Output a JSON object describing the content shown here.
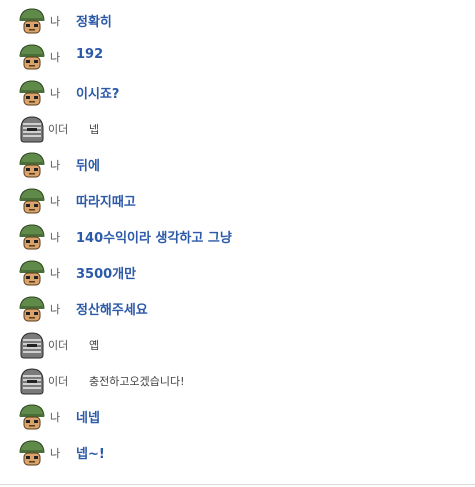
{
  "chat": {
    "messages": [
      {
        "sender": "나",
        "text": "정확히"
      },
      {
        "sender": "나",
        "text": "192"
      },
      {
        "sender": "나",
        "text": "이시죠?"
      },
      {
        "sender": "이더",
        "text": "넵"
      },
      {
        "sender": "나",
        "text": "뒤에"
      },
      {
        "sender": "나",
        "text": "따라지때고"
      },
      {
        "sender": "나",
        "text": "140수익이라 생각하고 그냥"
      },
      {
        "sender": "나",
        "text": "3500개만"
      },
      {
        "sender": "나",
        "text": "정산해주세요"
      },
      {
        "sender": "이더",
        "text": "옙"
      },
      {
        "sender": "이더",
        "text": "충전하고오겠습니다!"
      },
      {
        "sender": "나",
        "text": "네넵"
      },
      {
        "sender": "나",
        "text": "넵~!"
      }
    ],
    "avatar_icons": {
      "me": "soldier-green-helmet-icon",
      "other": "helmet-grey-visor-icon"
    },
    "colors": {
      "my_message_text": "#2c5aa8",
      "other_message_text": "#444444",
      "sender_label": "#555555",
      "helmet_green": "#5f8a4a",
      "helmet_grey": "#7a7a7a"
    }
  }
}
